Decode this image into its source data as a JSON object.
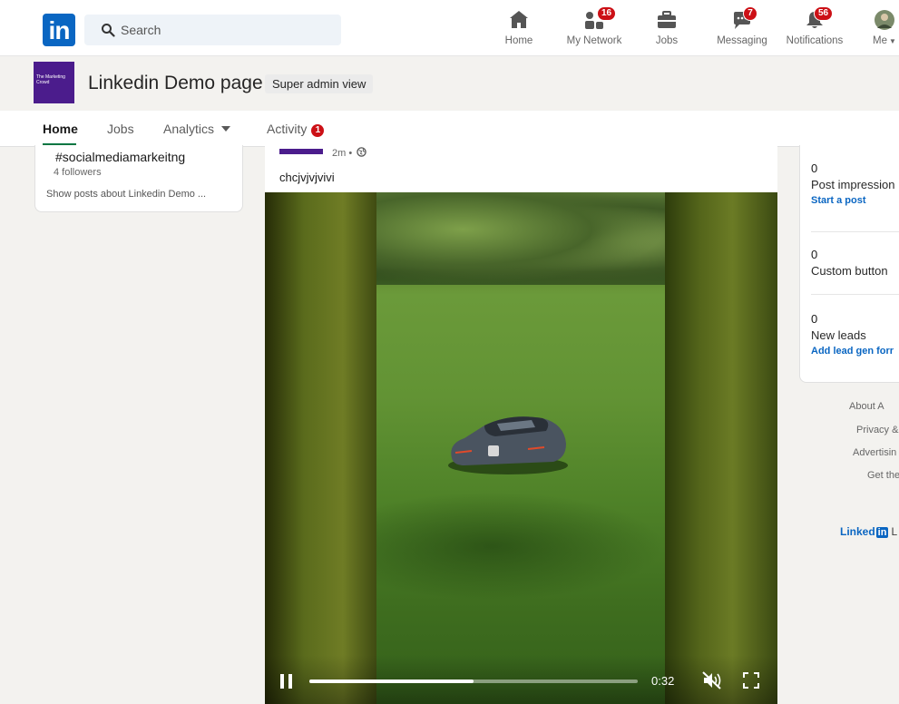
{
  "topnav": {
    "logo_text": "in",
    "search_placeholder": "Search",
    "items": [
      {
        "label": "Home",
        "icon": "home-icon",
        "badge": ""
      },
      {
        "label": "My Network",
        "icon": "network-icon",
        "badge": "16"
      },
      {
        "label": "Jobs",
        "icon": "jobs-icon",
        "badge": ""
      },
      {
        "label": "Messaging",
        "icon": "messaging-icon",
        "badge": "7"
      },
      {
        "label": "Notifications",
        "icon": "bell-icon",
        "badge": "56"
      },
      {
        "label": "Me",
        "icon": "avatar",
        "badge": ""
      }
    ]
  },
  "page": {
    "logo_text": "The Marketing Crowd",
    "title": "Linkedin Demo page",
    "view_badge": "Super admin view",
    "tabs": [
      {
        "label": "Home"
      },
      {
        "label": "Jobs"
      },
      {
        "label": "Analytics"
      },
      {
        "label": "Activity",
        "badge": "1"
      }
    ]
  },
  "left_card": {
    "hashtag": "#socialmediamarkeitng",
    "followers": "4 followers",
    "show_posts": "Show posts about Linkedin Demo ..."
  },
  "post": {
    "time": "2m •",
    "text": "chcjvjvjvivi",
    "video": {
      "time": "0:32",
      "progress": 0.5
    }
  },
  "right_card": {
    "stats": [
      {
        "value": "0",
        "label": "Post impression",
        "link": "Start a post"
      },
      {
        "value": "0",
        "label": "Custom button",
        "link": ""
      },
      {
        "value": "0",
        "label": "New leads",
        "link": "Add lead gen forr"
      }
    ]
  },
  "footer": {
    "links": [
      "About  A",
      "Privacy &",
      "Advertisin",
      "Get the"
    ],
    "brand": "Linked",
    "brand_in": "in",
    "brand_rest": "L"
  },
  "colors": {
    "brand_blue": "#0a66c2",
    "badge_red": "#cc1016",
    "active_tab_green": "#057642",
    "page_logo_purple": "#4b1c8c"
  }
}
